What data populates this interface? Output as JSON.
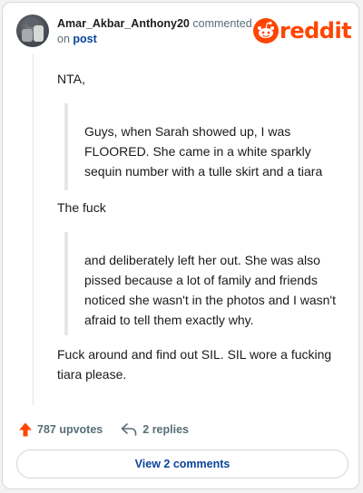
{
  "header": {
    "username": "Amar_Akbar_Anthony20",
    "action_text": "commented",
    "on_text": "on",
    "post_link": "post",
    "logo_text": "reddit"
  },
  "comment": {
    "p1": "NTA,",
    "quote1": "Guys, when Sarah showed up, I was FLOORED. She came in a white sparkly sequin number with a tulle skirt and a tiara",
    "p2": "The fuck",
    "quote2": "and deliberately left her out. She was also pissed because a lot of family and friends noticed she wasn't in the photos and I wasn't afraid to tell them exactly why.",
    "p3": "Fuck around and find out SIL. SIL wore a fucking tiara please."
  },
  "footer": {
    "upvotes": "787 upvotes",
    "replies": "2 replies",
    "view_comments": "View 2 comments"
  },
  "icons": {
    "upvote": "upvote-arrow-icon",
    "reply": "reply-arrow-icon",
    "logo": "reddit-snoo-icon"
  },
  "colors": {
    "brand": "#ff4500",
    "link": "#0a449b",
    "meta": "#576f76"
  }
}
